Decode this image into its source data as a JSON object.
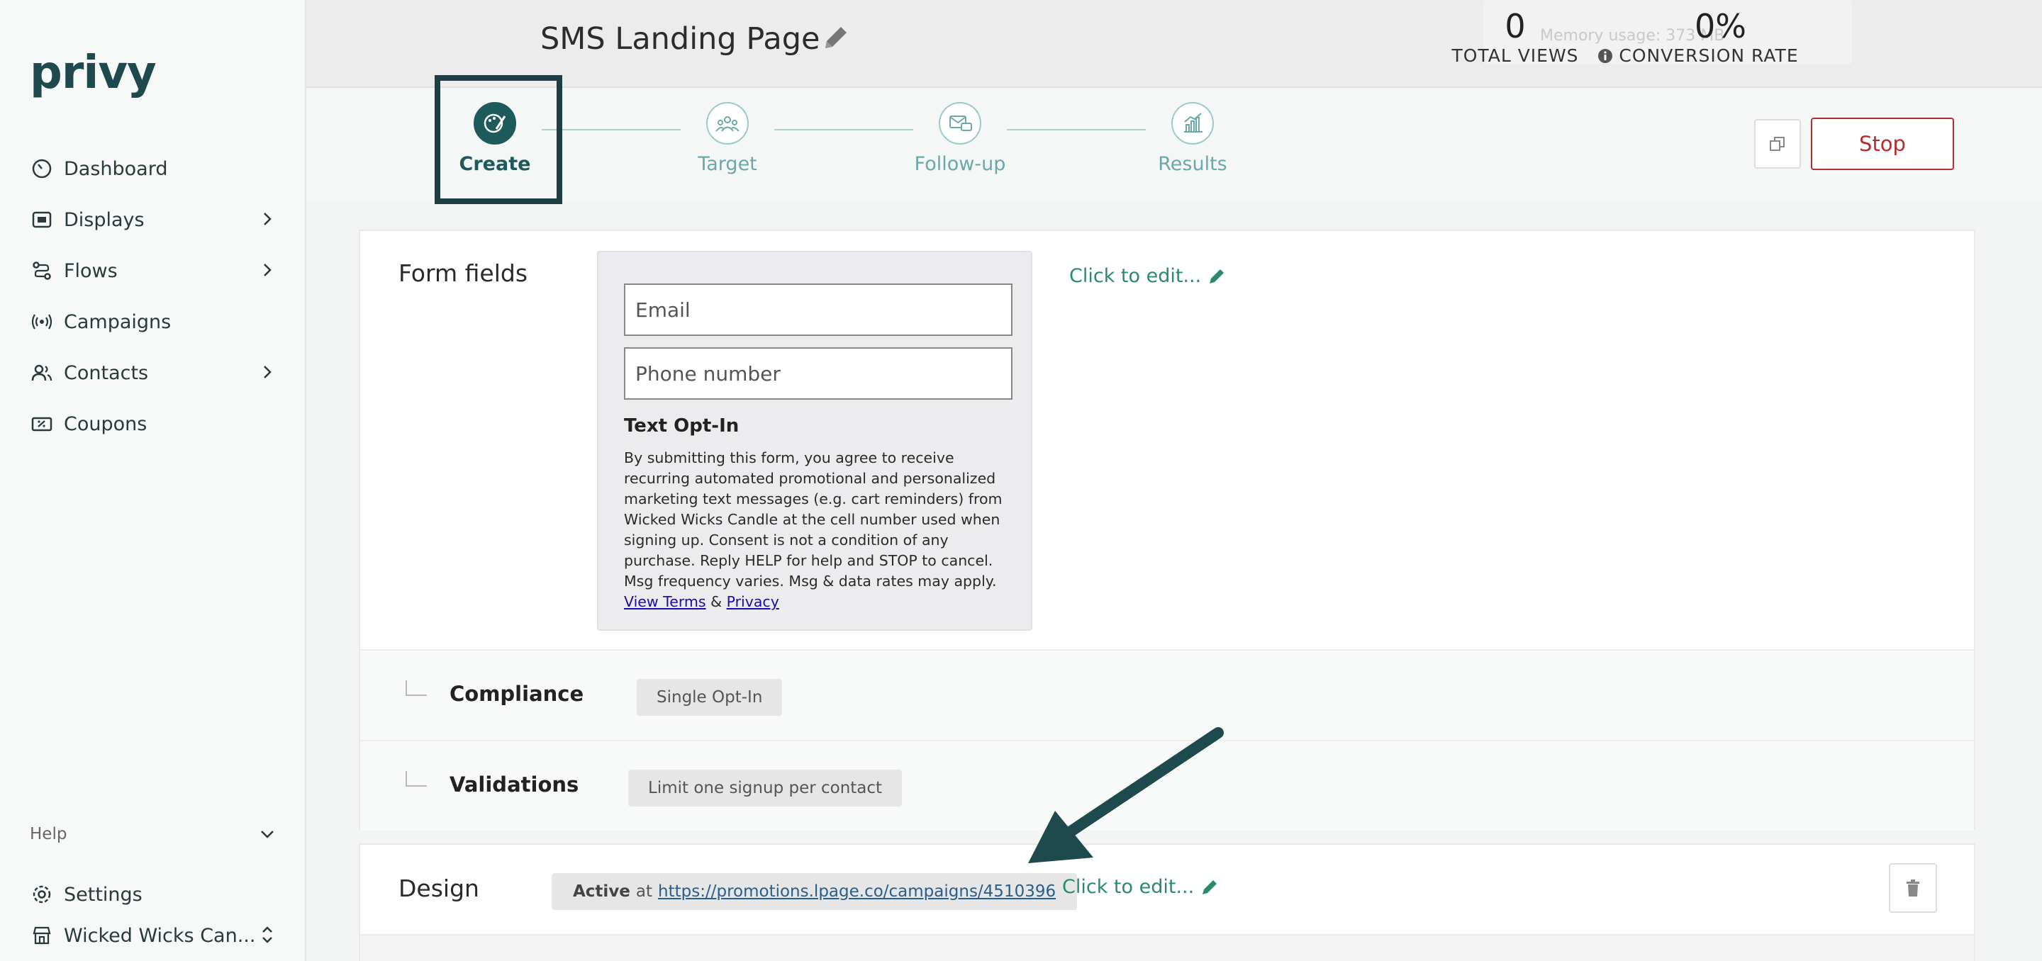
{
  "sidebar": {
    "logo": "privy",
    "items": [
      {
        "label": "Dashboard"
      },
      {
        "label": "Displays"
      },
      {
        "label": "Flows"
      },
      {
        "label": "Campaigns"
      },
      {
        "label": "Contacts"
      },
      {
        "label": "Coupons"
      }
    ],
    "help": "Help",
    "settings": "Settings",
    "store": "Wicked Wicks Can..."
  },
  "header": {
    "title": "SMS Landing Page",
    "memory": "Memory usage: 373 MB",
    "total_views": {
      "value": "0",
      "label": "TOTAL VIEWS"
    },
    "conversion_rate": {
      "value": "0%",
      "label": "CONVERSION RATE"
    }
  },
  "steps": [
    {
      "label": "Create",
      "active": true
    },
    {
      "label": "Target"
    },
    {
      "label": "Follow-up"
    },
    {
      "label": "Results"
    }
  ],
  "actions": {
    "stop": "Stop"
  },
  "form_fields": {
    "title": "Form fields",
    "email_placeholder": "Email",
    "phone_placeholder": "Phone number",
    "optin_title": "Text Opt-In",
    "optin_text": "By submitting this form, you agree to receive recurring automated promotional and personalized marketing text messages (e.g. cart reminders) from Wicked Wicks Candle at the cell number used when signing up. Consent is not a condition of any purchase. Reply HELP for help and STOP to cancel. Msg frequency varies. Msg & data rates may apply.",
    "terms_link": "View Terms",
    "amp": "&",
    "privacy_link": "Privacy",
    "edit": "Click to edit..."
  },
  "compliance": {
    "label": "Compliance",
    "value": "Single Opt-In"
  },
  "validations": {
    "label": "Validations",
    "value": "Limit one signup per contact"
  },
  "design": {
    "title": "Design",
    "status": "Active",
    "at": "at",
    "url": "https://promotions.lpage.co/campaigns/4510396",
    "edit": "Click to edit..."
  }
}
